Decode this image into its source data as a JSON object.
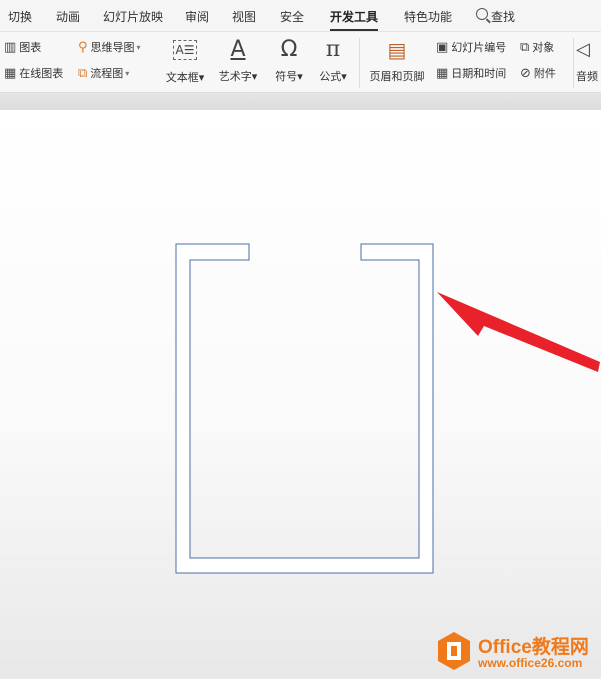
{
  "menubar": {
    "items": [
      "切换",
      "动画",
      "幻灯片放映",
      "审阅",
      "视图",
      "安全",
      "开发工具",
      "特色功能",
      "查找"
    ]
  },
  "toolbar": {
    "chart": "图表",
    "online_chart": "在线图表",
    "mindmap": "思维导图",
    "flowchart": "流程图",
    "textbox": "文本框",
    "wordart": "艺术字",
    "symbol": "符号",
    "formula": "公式",
    "header_footer": "页眉和页脚",
    "slide_number": "幻灯片编号",
    "datetime": "日期和时间",
    "object": "对象",
    "attachment": "附件",
    "audio": "音频",
    "dropdown_glyph": "▾",
    "symbol_glyph": "Ω",
    "formula_glyph": "π",
    "wordart_glyph": "A",
    "textbox_glyph": "A☰"
  },
  "slide": {
    "shape_stroke": "#4a6fa5",
    "arrow_color": "#e8212a"
  },
  "watermark": {
    "title": "Office教程网",
    "url": "www.office26.com",
    "brand_color": "#f07a1a"
  }
}
